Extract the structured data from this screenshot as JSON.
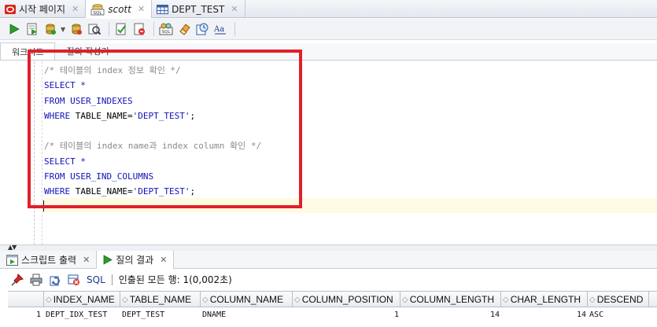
{
  "doc_tabs": [
    {
      "label": "시작 페이지",
      "icon": "oracle-start-icon"
    },
    {
      "label": "scott",
      "icon": "sql-connection-icon"
    },
    {
      "label": "DEPT_TEST",
      "icon": "table-icon"
    }
  ],
  "sub_tabs": [
    "워크시트",
    "질의 작성기"
  ],
  "editor": {
    "lines": [
      {
        "type": "comment",
        "text": "/* 테이블의 index 정보 확인 */"
      },
      {
        "type": "kw",
        "text": "SELECT *"
      },
      {
        "type": "kw",
        "text": "FROM USER_INDEXES"
      },
      {
        "type": "where",
        "text": "WHERE TABLE_NAME='DEPT_TEST';"
      },
      {
        "type": "blank",
        "text": ""
      },
      {
        "type": "comment",
        "text": "/* 테이블의 index name과 index column 확인 */"
      },
      {
        "type": "kw",
        "text": "SELECT *"
      },
      {
        "type": "kw",
        "text": "FROM USER_IND_COLUMNS"
      },
      {
        "type": "where",
        "text": "WHERE TABLE_NAME='DEPT_TEST';"
      }
    ]
  },
  "panel_tabs": [
    {
      "label": "스크립트 출력",
      "icon": "script-output-icon"
    },
    {
      "label": "질의 결과",
      "icon": "run-icon"
    }
  ],
  "results": {
    "sql_label": "SQL",
    "status": "인출된 모든 행: 1(0,002초)",
    "columns": [
      "INDEX_NAME",
      "TABLE_NAME",
      "COLUMN_NAME",
      "COLUMN_POSITION",
      "COLUMN_LENGTH",
      "CHAR_LENGTH",
      "DESCEND"
    ],
    "rows": [
      {
        "rownum": "1",
        "cells": [
          "DEPT_IDX_TEST",
          "DEPT_TEST",
          "DNAME",
          "1",
          "14",
          "14",
          "ASC"
        ]
      }
    ]
  },
  "colors": {
    "highlight_box": "#e0202a",
    "keyword": "#1313b8",
    "comment": "#8a8a8a"
  }
}
